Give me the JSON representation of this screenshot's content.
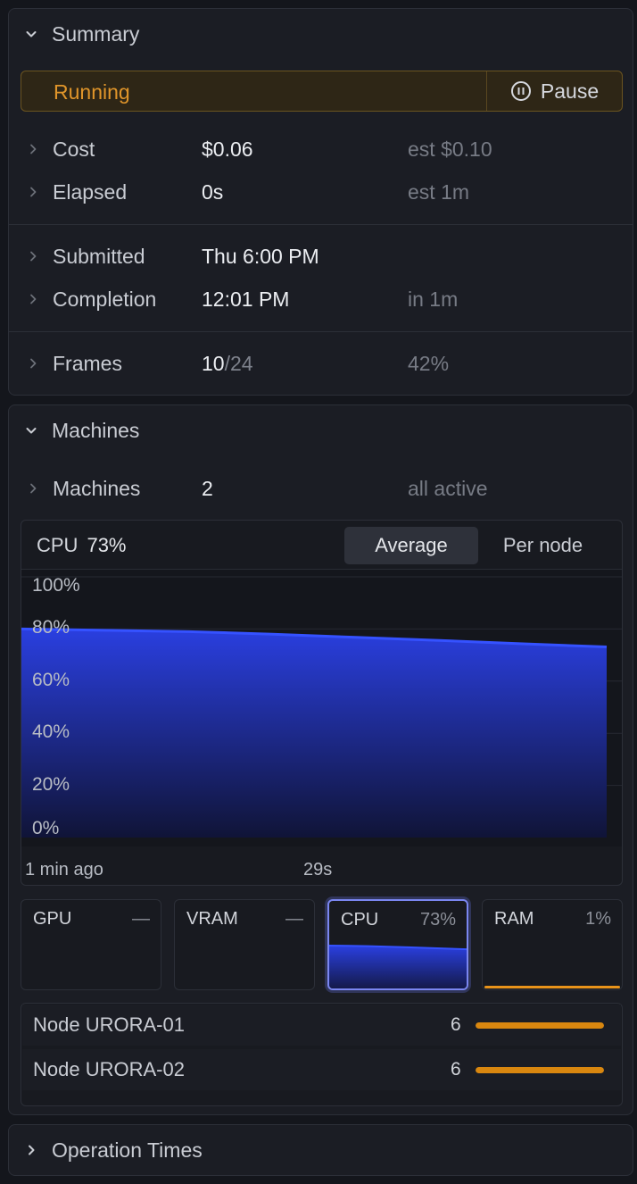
{
  "summary": {
    "title": "Summary",
    "status": "Running",
    "pause_label": "Pause",
    "rows": [
      {
        "label": "Cost",
        "value": "$0.06",
        "extra": "est $0.10"
      },
      {
        "label": "Elapsed",
        "value": "0s",
        "extra": "est 1m"
      },
      {
        "label": "Submitted",
        "value": "Thu 6:00 PM",
        "extra": ""
      },
      {
        "label": "Completion",
        "value": "12:01 PM",
        "extra": "in 1m"
      }
    ],
    "frames": {
      "label": "Frames",
      "done": "10",
      "total": "/24",
      "extra": "42%"
    }
  },
  "machines": {
    "title": "Machines",
    "row": {
      "label": "Machines",
      "value": "2",
      "extra": "all active"
    },
    "chart": {
      "metric_label": "CPU",
      "metric_value": "73%",
      "view_options": [
        "Average",
        "Per node"
      ],
      "selected_view": "Average"
    },
    "tiles": [
      {
        "name": "GPU",
        "value": "—",
        "color": "",
        "level": null
      },
      {
        "name": "VRAM",
        "value": "—",
        "color": "",
        "level": null
      },
      {
        "name": "CPU",
        "value": "73%",
        "color": "#2a3fe0",
        "level": 0.73,
        "selected": true
      },
      {
        "name": "RAM",
        "value": "1%",
        "color": "#e8931a",
        "level": 0.01
      }
    ],
    "nodes": [
      {
        "name": "Node URORA-01",
        "count": "6",
        "fill": 1.0
      },
      {
        "name": "Node URORA-02",
        "count": "6",
        "fill": 1.0
      }
    ]
  },
  "operation_times": {
    "title": "Operation Times"
  },
  "chart_data": {
    "type": "area",
    "title": "",
    "xlabel": "",
    "ylabel": "",
    "x_tick_labels": [
      "1 min ago",
      "29s"
    ],
    "y_ticks": [
      "100%",
      "80%",
      "60%",
      "40%",
      "20%",
      "0%"
    ],
    "ylim": [
      0,
      100
    ],
    "series": [
      {
        "values": [
          80,
          79.5,
          79,
          78,
          76.8,
          75.6,
          74.3,
          73.1
        ]
      }
    ],
    "grid": true,
    "color": "#2a3fe0"
  }
}
